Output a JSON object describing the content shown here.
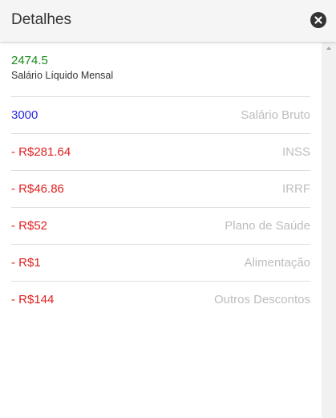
{
  "header": {
    "title": "Detalhes",
    "close_icon": "close-icon"
  },
  "summary": {
    "net_value": "2474.5",
    "net_label": "Salário Líquido Mensal",
    "net_color": "#1a8a1a"
  },
  "rows": [
    {
      "value": "3000",
      "label": "Salário Bruto",
      "color": "#2a2ae0"
    },
    {
      "value": "- R$281.64",
      "label": "INSS",
      "color": "#e02020"
    },
    {
      "value": "- R$46.86",
      "label": "IRRF",
      "color": "#e02020"
    },
    {
      "value": "- R$52",
      "label": "Plano de Saúde",
      "color": "#e02020"
    },
    {
      "value": "- R$1",
      "label": "Alimentação",
      "color": "#e02020"
    },
    {
      "value": "- R$144",
      "label": "Outros Descontos",
      "color": "#e02020"
    }
  ]
}
